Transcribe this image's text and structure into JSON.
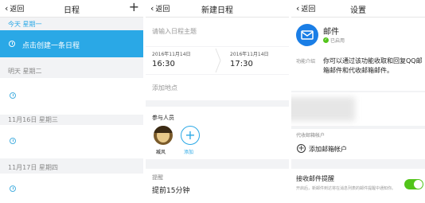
{
  "left": {
    "back_label": "返回",
    "title": "日程",
    "today_label": "今天 星期一",
    "create_item_label": "点击创建一条日程",
    "tomorrow_label": "明天 星期二",
    "day2_label": "11月16日 星期三",
    "day3_label": "11月17日 星期四"
  },
  "middle": {
    "back_label": "返回",
    "title": "新建日程",
    "subject_placeholder": "请输入日程主题",
    "start_date": "2016年11月14日",
    "start_time": "16:30",
    "end_date": "2016年11月14日",
    "end_time": "17:30",
    "location_placeholder": "添加地点",
    "participants_label": "参与人员",
    "participant_name": "臧风",
    "add_label": "添加",
    "reminder_label": "提醒",
    "reminder_value": "提前15分钟"
  },
  "right": {
    "back_label": "返回",
    "title": "设置",
    "app_name": "邮件",
    "app_status": "已启用",
    "intro_label": "功能介绍",
    "intro_text": "你可以通过该功能收取和回复QQ邮箱邮件和代收邮箱邮件。",
    "accounts_label": "代收邮箱帐户",
    "add_account_label": "添加邮箱帐户",
    "notify_label": "接收邮件提醒",
    "notify_desc": "开启后，新邮件到达将在消息列表的邮件提醒中通知你。",
    "notify_on": true
  },
  "colors": {
    "accent": "#2aa8e6",
    "toggle_green": "#52c41a",
    "mail_blue": "#1a7ee6"
  }
}
